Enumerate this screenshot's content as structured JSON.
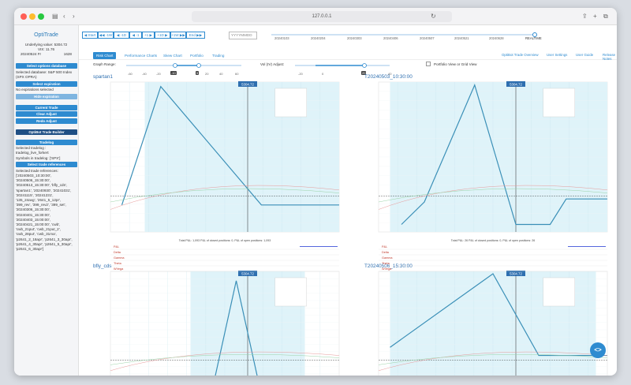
{
  "browser": {
    "url": "127.0.0.1"
  },
  "sidebar": {
    "brand": "OptiTrade",
    "underlying_label": "Underlying value:",
    "underlying_value": "5304.72",
    "vix_label": "VIX:",
    "vix_value": "11.76",
    "date_label": "20240524 Fr",
    "time_value": "1628",
    "btn_select_db": "Select options database",
    "db_text": "Selected database: S&P 500 Index (SPX OPRA)",
    "btn_select_exp": "Select expiration",
    "exp_text": "No expirations selected",
    "btn_hide_exp": "Hide expiration",
    "btn_current_trade": "Current Trade",
    "btn_clear_adjust": "Clear Adjust",
    "btn_redo_adjust": "Redo Adjust",
    "btn_builder": "OptiBot Trade Builder",
    "btn_tradelog": "Tradelog",
    "tradelog_lines": [
      "Selected tradelog :",
      "tradelog_live_forkert",
      "Symbols in tradelog: ['SPX']"
    ],
    "btn_select_refs": "Select trade references",
    "refs_lines": [
      "Selected trade references:",
      "['20240503_10:30:00',",
      "'20240506_15:30:00',",
      "'20240513_15:30:00', 'bfly_cds',",
      "'spartan1', '20240930', '20241031',",
      "'20241115', '20241231',",
      "'135_24avg', '2641_5_12pr',",
      "'399_rev', '399_rev2', '399_set',",
      "'20240306_15:30:00',",
      "'20240401_15:30:00',",
      "'20240403_15:00:00',",
      "'20240421_15:00:00', 'cwb',",
      "'cwb_21put', 'cwb_21put_2',",
      "'cwb_28put', 'cwb_31ma',",
      "'p2641_2_18apr', 'p2641_3_30apr',",
      "'p2641_4_30apr', 'p2641_5_30apr',",
      "'p2641_6_30apr']"
    ]
  },
  "toolbar": {
    "start": "◀ Start",
    "m1w": "◀◀ -1W",
    "m1d": "◀ -1D",
    "m1": "◀ -1",
    "p1": "+1 ▶",
    "p1d": "+1D ▶",
    "p1w": "+1W ▶▶",
    "end": "End ▶▶",
    "date_placeholder": "YYYYMMDD",
    "timeline": [
      "20240103",
      "20240204",
      "20240303",
      "20240406",
      "20240507",
      "20240521",
      "20240628",
      "REALTIME"
    ]
  },
  "tabs": [
    "Risk Chart",
    "Performance Charts",
    "Skew Chart",
    "Portfolio",
    "Trading"
  ],
  "right_links": [
    "OptiBot Trade Overview",
    "User Settings",
    "User Guide",
    "Release Notes"
  ],
  "controls": {
    "graph_range_label": "Graph Range:",
    "graph_ticks": [
      "-60",
      "-40",
      "-20",
      "-10",
      "0",
      "20",
      "40",
      "60"
    ],
    "graph_low": "-10",
    "graph_high": "5",
    "iv_label": "Vol (IV) Adjust:",
    "iv_ticks": [
      "-20",
      "0",
      "20",
      "40"
    ],
    "iv_value": "20",
    "portfolio_label": "Portfolio View or Grid View"
  },
  "panels": [
    {
      "title": "spartan1",
      "price_label": "5304.72",
      "table_note": "Total P&L: 1,093 P&L of closed positions: 0, P&L of open positions: 1,093"
    },
    {
      "title": "T20240503_10:30:00",
      "price_label": "5304.72",
      "table_note": "Total P&L: 26 P&L of closed positions: 0, P&L of open positions: 26"
    },
    {
      "title": "bfly_cds",
      "price_label": "5304.72"
    },
    {
      "title": "T20240506_15:30:00",
      "price_label": "5304.72"
    }
  ],
  "greek_rows": [
    "P&L",
    "Delta",
    "Gamma",
    "Theta",
    "WVega"
  ],
  "fab_icon": "code-icon",
  "fab_glyph": "<>"
}
